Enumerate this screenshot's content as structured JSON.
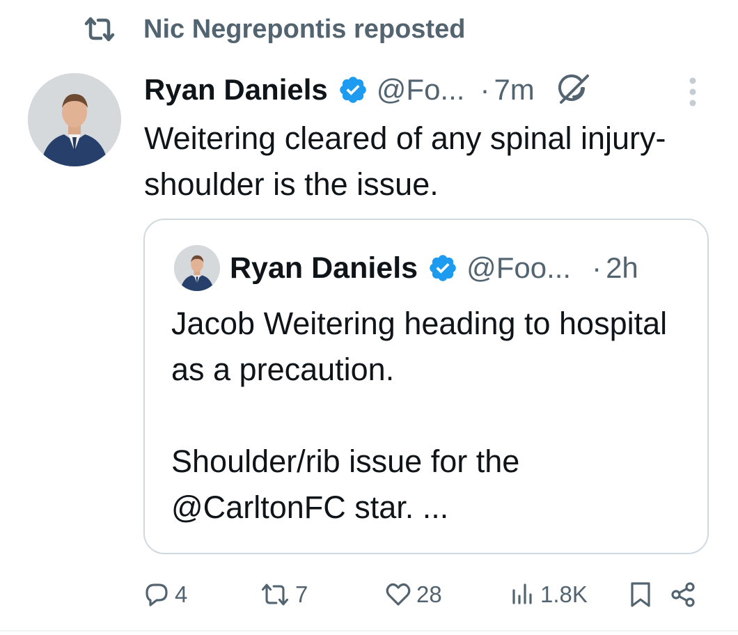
{
  "repost": {
    "label": "Nic Negrepontis reposted"
  },
  "tweet": {
    "author_name": "Ryan Daniels",
    "handle": "@Fo...",
    "separator": "·",
    "time": "7m",
    "text": "Weitering cleared of any spinal injury- shoulder is the issue."
  },
  "quote": {
    "author_name": "Ryan Daniels",
    "handle": "@Foo...",
    "separator": "·",
    "time": "2h",
    "text": "Jacob Weitering heading to hospital as a precaution.\n\nShoulder/rib issue for the @CarltonFC star. ..."
  },
  "actions": {
    "replies": "4",
    "reposts": "7",
    "likes": "28",
    "views": "1.8K"
  },
  "icons": {
    "repost": "repost-icon",
    "verified": "verified-badge-icon",
    "grok": "grok-icon",
    "more": "more-vertical-icon",
    "reply": "reply-icon",
    "like": "heart-icon",
    "views": "views-icon",
    "bookmark": "bookmark-icon",
    "share": "share-icon"
  },
  "colors": {
    "text": "#0f1419",
    "muted": "#536471",
    "verified": "#1d9bf0",
    "border": "#cfd9de"
  }
}
